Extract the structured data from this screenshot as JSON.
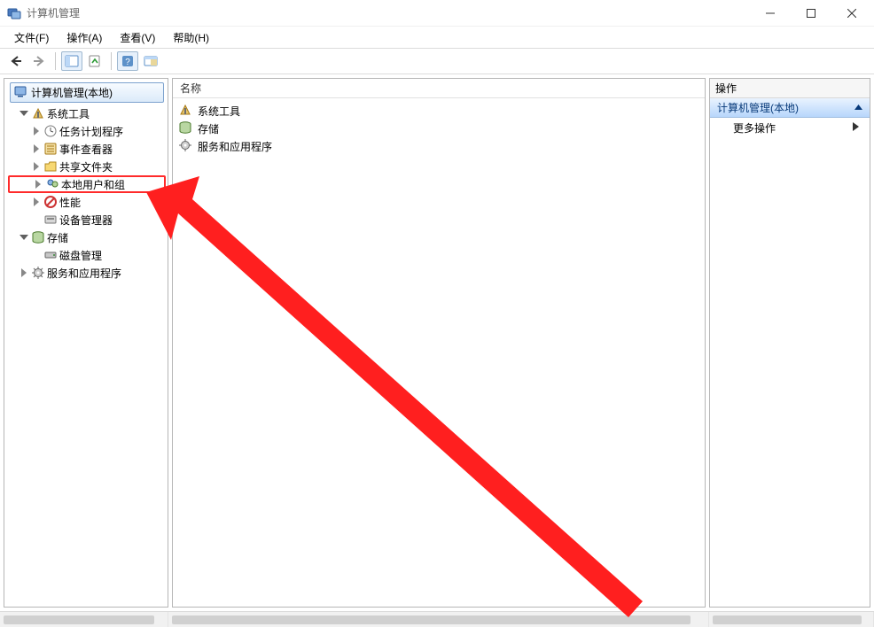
{
  "window": {
    "title": "计算机管理"
  },
  "menus": {
    "file": "文件(F)",
    "action": "操作(A)",
    "view": "查看(V)",
    "help": "帮助(H)"
  },
  "tree": {
    "root": "计算机管理(本地)",
    "system_tools": "系统工具",
    "task_scheduler": "任务计划程序",
    "event_viewer": "事件查看器",
    "shared_folders": "共享文件夹",
    "local_users_groups": "本地用户和组",
    "performance": "性能",
    "device_manager": "设备管理器",
    "storage": "存储",
    "disk_management": "磁盘管理",
    "services_apps": "服务和应用程序"
  },
  "list": {
    "column_name": "名称",
    "items": {
      "system_tools": "系统工具",
      "storage": "存储",
      "services_apps": "服务和应用程序"
    }
  },
  "actions": {
    "header": "操作",
    "section": "计算机管理(本地)",
    "more": "更多操作"
  }
}
